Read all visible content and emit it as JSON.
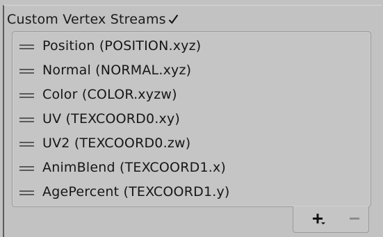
{
  "header": {
    "label": "Custom Vertex Streams",
    "checked": true
  },
  "streams": [
    {
      "label": "Position (POSITION.xyz)"
    },
    {
      "label": "Normal (NORMAL.xyz)"
    },
    {
      "label": "Color (COLOR.xyzw)"
    },
    {
      "label": "UV (TEXCOORD0.xy)"
    },
    {
      "label": "UV2 (TEXCOORD0.zw)"
    },
    {
      "label": "AnimBlend (TEXCOORD1.x)"
    },
    {
      "label": "AgePercent (TEXCOORD1.y)"
    }
  ],
  "footer": {
    "add_icon": "plus-dropdown-icon",
    "remove_icon": "minus-icon"
  },
  "colors": {
    "background": "#c2c2c2",
    "panel": "#c5c5c5",
    "text": "#161616",
    "handle": "#5a5a5a",
    "disabled": "#8c8c8c"
  }
}
